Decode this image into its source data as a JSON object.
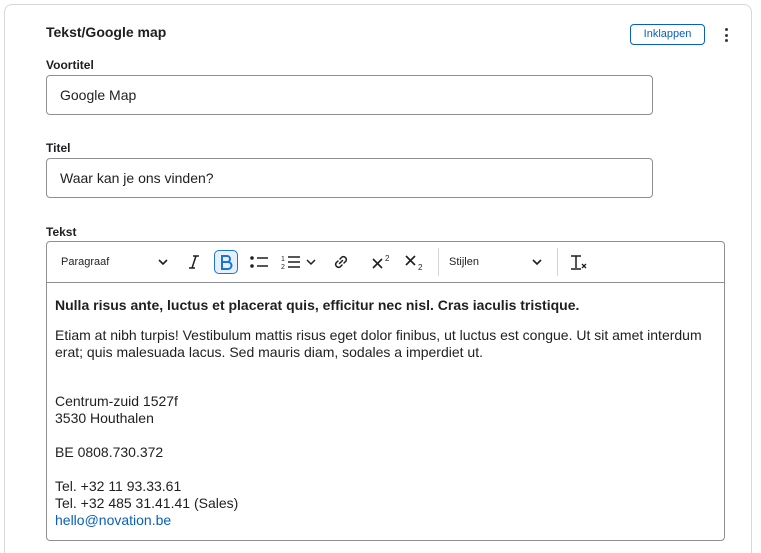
{
  "panel": {
    "title": "Tekst/Google map",
    "collapse_label": "Inklappen",
    "more_icon": "kebab-vertical-icon"
  },
  "fields": {
    "voortitel": {
      "label": "Voortitel",
      "value": "Google Map"
    },
    "titel": {
      "label": "Titel",
      "value": "Waar kan je ons vinden?"
    },
    "tekst": {
      "label": "Tekst"
    }
  },
  "toolbar": {
    "paragraph_select": "Paragraaf",
    "styles_select": "Stijlen",
    "buttons": [
      "italic-icon",
      "bold-icon",
      "bulleted-list-icon",
      "numbered-list-icon",
      "link-icon",
      "superscript-icon",
      "subscript-icon",
      "remove-format-icon"
    ],
    "active_color": "#1c72d8"
  },
  "content": {
    "lead": "Nulla risus ante, luctus et placerat quis, efficitur nec nisl. Cras iaculis tristique.",
    "body": "Etiam at nibh turpis! Vestibulum mattis risus eget dolor finibus, ut luctus est congue. Ut sit amet interdum erat; quis malesuada lacus. Sed mauris diam, sodales a imperdiet ut.",
    "street": "Centrum-zuid 1527f",
    "city": "3530 Houthalen",
    "vat": "BE 0808.730.372",
    "phone1": "Tel. +32 11 93.33.61",
    "phone2": "Tel. +32 485 31.41.41 (Sales)",
    "email": "hello@novation.be"
  },
  "colors": {
    "link": "#0a5ebd",
    "border": "#8d8f96"
  }
}
